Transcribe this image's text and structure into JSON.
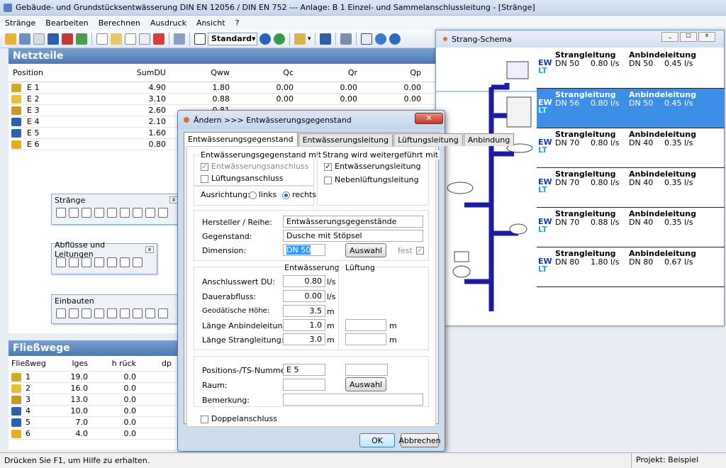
{
  "app": {
    "title": "Gebäude- und Grundstücksentwässerung DIN EN 12056 / DIN EN 752 --- Anlage: B 1 Einzel- und Sammelanschlussleitung - [Stränge]"
  },
  "menu": [
    "Stränge",
    "Bearbeiten",
    "Berechnen",
    "Ausdruck",
    "Ansicht",
    "?"
  ],
  "toolbar": {
    "combo": "Standard"
  },
  "netzteile": {
    "title": "Netzteile",
    "headers": [
      "Position",
      "SumDU",
      "Qww",
      "Qc",
      "Qr",
      "Qp"
    ],
    "rows": [
      [
        "E 1",
        "4.90",
        "1.80",
        "0.00",
        "0.00",
        "0.00"
      ],
      [
        "E 2",
        "3.10",
        "0.88",
        "0.00",
        "0.00",
        "0.00"
      ],
      [
        "E 3",
        "2.60",
        "0.81",
        "",
        "",
        ""
      ],
      [
        "E 4",
        "2.10",
        "",
        "",
        "",
        ""
      ],
      [
        "E 5",
        "1.60",
        "",
        "",
        "",
        ""
      ],
      [
        "E 6",
        "0.80",
        "",
        "",
        "",
        ""
      ]
    ]
  },
  "tools": {
    "straenge": "Stränge",
    "abfluesse": "Abflüsse und Leitungen",
    "einbauten": "Einbauten"
  },
  "fliesswege": {
    "title": "Fließwege",
    "headers": [
      "Fließweg",
      "lges",
      "h rück",
      "dp"
    ],
    "rows": [
      [
        "1",
        "19.0",
        "0.0"
      ],
      [
        "2",
        "16.0",
        "0.0"
      ],
      [
        "3",
        "13.0",
        "0.0"
      ],
      [
        "4",
        "10.0",
        "0.0"
      ],
      [
        "5",
        "7.0",
        "0.0"
      ],
      [
        "6",
        "4.0",
        "0.0"
      ]
    ]
  },
  "status": {
    "help": "Drücken Sie F1, um Hilfe zu erhalten.",
    "projekt": "Projekt: Beispiel"
  },
  "schema": {
    "title": "Strang-Schema",
    "ew": "EW",
    "lt": "LT",
    "col1": "Strangleitung",
    "col2": "Anbindeleitung",
    "rows": [
      [
        "DN 50",
        "0.80 l/s",
        "DN 50",
        "0.45 l/s"
      ],
      [
        "DN 56",
        "0.80 l/s",
        "DN 50",
        "0.45 l/s"
      ],
      [
        "DN 70",
        "0.80 l/s",
        "DN 40",
        "0.35 l/s"
      ],
      [
        "DN 70",
        "0.80 l/s",
        "DN 40",
        "0.35 l/s"
      ],
      [
        "DN 70",
        "0.88 l/s",
        "DN 40",
        "0.35 l/s"
      ],
      [
        "DN 80",
        "1.80 l/s",
        "DN 80",
        "0.67 l/s"
      ]
    ]
  },
  "dialog": {
    "title": "Ändern >>> Entwässerungsgegenstand",
    "tabs": [
      "Entwässerungsgegenstand",
      "Entwässerungsleitung",
      "Lüftungsleitung",
      "Anbindung"
    ],
    "g1": "Entwässerungsgegenstand mit",
    "cb1": "Entwässerungsanschluss",
    "cb2": "Lüftungsanschluss",
    "g2": "Strang wird weitergeführt mit",
    "cb3": "Entwässerungsleitung",
    "cb4": "Nebenlüftungsleitung",
    "ausrichtung": "Ausrichtung:",
    "links": "links",
    "rechts": "rechts",
    "hersteller_l": "Hersteller / Reihe:",
    "hersteller_v": "Entwässerungsgegenstände",
    "gegenstand_l": "Gegenstand:",
    "gegenstand_v": "Dusche mit Stöpsel",
    "dimension_l": "Dimension:",
    "dimension_v": "DN 50",
    "auswahl": "Auswahl",
    "fest": "fest",
    "ent": "Entwässerung",
    "lue": "Lüftung",
    "du_l": "Anschlusswert DU:",
    "du_v": "0.80",
    "du_u": "l/s",
    "da_l": "Dauerabfluss:",
    "da_v": "0.00",
    "da_u": "l/s",
    "gh_l": "Geodätische Höhe:",
    "gh_v": "3.5",
    "gh_u": "m",
    "la_l": "Länge Anbindeleitung:",
    "la_v": "1.0",
    "la_u": "m",
    "la_u2": "m",
    "ls_l": "Länge Strangleitung:",
    "ls_v": "3.0",
    "ls_u": "m",
    "ls_u2": "m",
    "pos_l": "Positions-/TS-Nummer:",
    "pos_v": "E 5",
    "raum_l": "Raum:",
    "bem_l": "Bemerkung:",
    "doppel": "Doppelanschluss",
    "ok": "OK",
    "abbrechen": "Abbrechen"
  }
}
